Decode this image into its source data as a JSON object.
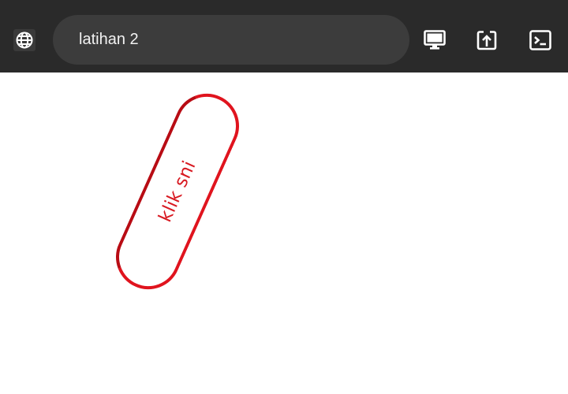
{
  "toolbar": {
    "address_text": "latihan 2",
    "icons": {
      "left": "globe-icon",
      "right": [
        "monitor-icon",
        "open-in-icon",
        "terminal-icon"
      ]
    }
  },
  "content": {
    "button_label": "klik sni"
  },
  "colors": {
    "toolbar_bg": "#2a2a2a",
    "address_bg": "#3c3c3c",
    "accent_red": "#e0141e"
  }
}
